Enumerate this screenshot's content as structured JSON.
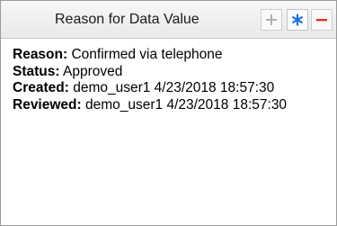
{
  "header": {
    "title": "Reason for Data Value",
    "add_icon": "plus-icon",
    "mark_icon": "asterisk-icon",
    "remove_icon": "minus-icon"
  },
  "details": {
    "reason_label": "Reason:",
    "reason_value": "Confirmed via telephone",
    "status_label": "Status:",
    "status_value": "Approved",
    "created_label": "Created:",
    "created_value": "demo_user1 4/23/2018 18:57:30",
    "reviewed_label": "Reviewed:",
    "reviewed_value": "demo_user1 4/23/2018 18:57:30"
  },
  "colors": {
    "add": "#b0b0b0",
    "mark": "#1e6fe0",
    "remove": "#e0322b"
  }
}
